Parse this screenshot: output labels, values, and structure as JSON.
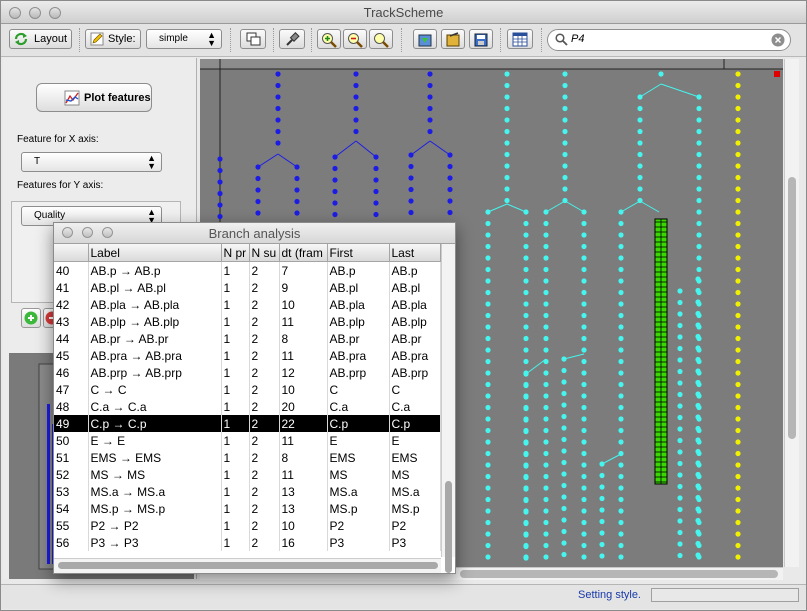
{
  "window": {
    "title": "TrackScheme"
  },
  "toolbar": {
    "layout_label": "Layout",
    "style_label": "Style:",
    "style_value": "simple",
    "search_value": "P4"
  },
  "left_panel": {
    "plot_button_label": "Plot features",
    "x_axis_label": "Feature for X axis:",
    "x_axis_value": "T",
    "y_axis_label": "Features for Y axis:",
    "y_axis_value": "Quality"
  },
  "status": {
    "text": "Setting style."
  },
  "colors": {
    "lineage_blue": "#1c1ce6",
    "lineage_cyan": "#45f5ee",
    "lineage_yellow": "#f0f000",
    "lineage_green": "#39d800",
    "canvas_bg": "#7c7c7c"
  },
  "dialog": {
    "title": "Branch analysis",
    "columns": [
      "",
      "Label",
      "N pr",
      "N su",
      "dt (fram",
      "First",
      "Last"
    ],
    "rows": [
      [
        "40",
        "AB.p → AB.p",
        "1",
        "2",
        "7",
        "AB.p",
        "AB.p"
      ],
      [
        "41",
        "AB.pl → AB.pl",
        "1",
        "2",
        "9",
        "AB.pl",
        "AB.pl"
      ],
      [
        "42",
        "AB.pla → AB.pla",
        "1",
        "2",
        "10",
        "AB.pla",
        "AB.pla"
      ],
      [
        "43",
        "AB.plp → AB.plp",
        "1",
        "2",
        "11",
        "AB.plp",
        "AB.plp"
      ],
      [
        "44",
        "AB.pr → AB.pr",
        "1",
        "2",
        "8",
        "AB.pr",
        "AB.pr"
      ],
      [
        "45",
        "AB.pra → AB.pra",
        "1",
        "2",
        "11",
        "AB.pra",
        "AB.pra"
      ],
      [
        "46",
        "AB.prp → AB.prp",
        "1",
        "2",
        "12",
        "AB.prp",
        "AB.prp"
      ],
      [
        "47",
        "C → C",
        "1",
        "2",
        "10",
        "C",
        "C"
      ],
      [
        "48",
        "C.a → C.a",
        "1",
        "2",
        "20",
        "C.a",
        "C.a"
      ],
      [
        "49",
        "C.p → C.p",
        "1",
        "2",
        "22",
        "C.p",
        "C.p"
      ],
      [
        "50",
        "E → E",
        "1",
        "2",
        "11",
        "E",
        "E"
      ],
      [
        "51",
        "EMS → EMS",
        "1",
        "2",
        "8",
        "EMS",
        "EMS"
      ],
      [
        "52",
        "MS → MS",
        "1",
        "2",
        "11",
        "MS",
        "MS"
      ],
      [
        "53",
        "MS.a → MS.a",
        "1",
        "2",
        "13",
        "MS.a",
        "MS.a"
      ],
      [
        "54",
        "MS.p → MS.p",
        "1",
        "2",
        "13",
        "MS.p",
        "MS.p"
      ],
      [
        "55",
        "P2 → P2",
        "1",
        "2",
        "10",
        "P2",
        "P2"
      ],
      [
        "56",
        "P3 → P3",
        "1",
        "2",
        "16",
        "P3",
        "P3"
      ]
    ],
    "selected_row": 9
  }
}
